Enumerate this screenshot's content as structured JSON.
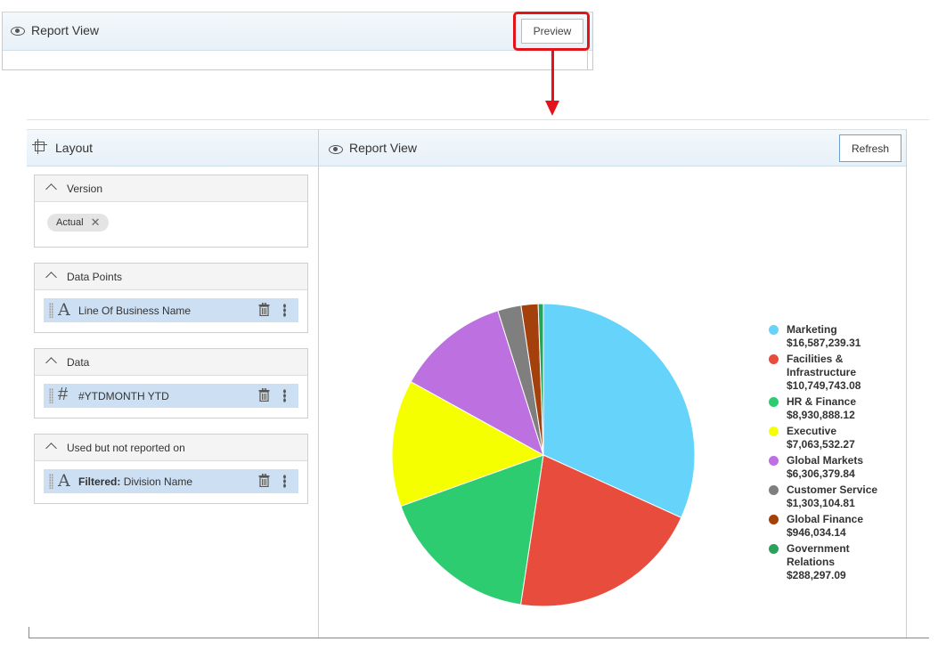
{
  "top_panel": {
    "title": "Report View",
    "preview_label": "Preview"
  },
  "layout_panel": {
    "title": "Layout",
    "sections": [
      {
        "title": "Version",
        "chip": "Actual"
      },
      {
        "title": "Data Points",
        "item": {
          "type_icon": "text-type-icon",
          "text": "Line Of Business Name"
        }
      },
      {
        "title": "Data",
        "item": {
          "type_icon": "number-type-icon",
          "text": "#YTDMONTH YTD"
        }
      },
      {
        "title": "Used but not reported on",
        "item": {
          "type_icon": "text-type-icon",
          "prefix": "Filtered:",
          "text": "Division Name"
        }
      }
    ]
  },
  "report_panel": {
    "title": "Report View",
    "refresh_label": "Refresh"
  },
  "colors": {
    "highlight": "#e3131a",
    "header_bg": "#e7f1f8",
    "item_bg": "#cde0f3"
  },
  "chart_data": {
    "type": "pie",
    "series": [
      {
        "name": "Marketing",
        "label": "$16,587,239.31",
        "value": 16587239.31,
        "color": "#66d3fa"
      },
      {
        "name": "Facilities & Infrastructure",
        "label": "$10,749,743.08",
        "value": 10749743.08,
        "color": "#e84c3d"
      },
      {
        "name": "HR & Finance",
        "label": "$8,930,888.12",
        "value": 8930888.12,
        "color": "#2ecc71"
      },
      {
        "name": "Executive",
        "label": "$7,063,532.27",
        "value": 7063532.27,
        "color": "#f6ff00"
      },
      {
        "name": "Global Markets",
        "label": "$6,306,379.84",
        "value": 6306379.84,
        "color": "#bd70e0"
      },
      {
        "name": "Customer Service",
        "label": "$1,303,104.81",
        "value": 1303104.81,
        "color": "#7f7f7f"
      },
      {
        "name": "Global Finance",
        "label": "$946,034.14",
        "value": 946034.14,
        "color": "#a3400c"
      },
      {
        "name": "Government Relations",
        "label": "$288,297.09",
        "value": 288297.09,
        "color": "#27a35a"
      }
    ],
    "legend_position": "right"
  }
}
